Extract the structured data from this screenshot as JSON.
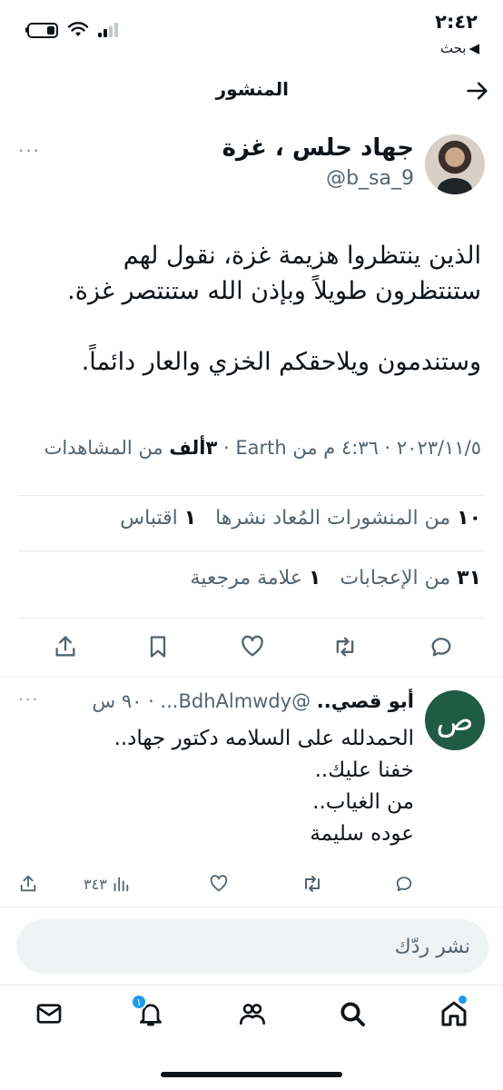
{
  "status_bar": {
    "time": "٢:٤٢",
    "back_label": "بحث"
  },
  "header": {
    "title": "المنشور"
  },
  "post": {
    "author_name": "جهاد حلس ، غزة",
    "author_handle": "@b_sa_9",
    "text_lines": [
      "الذين ينتظروا هزيمة غزة، نقول لهم",
      "ستنتظرون طويلاً وبإذن الله ستنتصر غزة.",
      "وستندمون ويلاحقكم الخزي والعار دائماً."
    ],
    "meta_prefix": "٢٠٢٣/١١/٥ · ٤:٣٦ م من Earth ·",
    "views_count": "٣ألف",
    "views_label": "من المشاهدات",
    "reposts_count": "١٠",
    "reposts_label": "من المنشورات المُعاد نشرها",
    "quotes_count": "١",
    "quotes_label": "اقتباس",
    "likes_count": "٣١",
    "likes_label": "من الإعجابات",
    "bookmarks_count": "١",
    "bookmarks_label": "علامة مرجعية"
  },
  "reply": {
    "avatar_letter": "ص",
    "author_name": "أبو قصي..",
    "handle_time": "@BdhAlmwdy... · ٩٠ س",
    "text_lines": [
      "الحمدلله على السلامه دكتور جهاد..",
      "خفنا عليك..",
      "من الغياب..",
      "عوده سليمة"
    ],
    "views": "٣٤٣"
  },
  "composer": {
    "placeholder": "نشر ردّك"
  },
  "nav": {
    "notifications_badge": "١"
  },
  "colors": {
    "accent": "#1d9bf0",
    "muted": "#536471",
    "text": "#0f1419"
  }
}
